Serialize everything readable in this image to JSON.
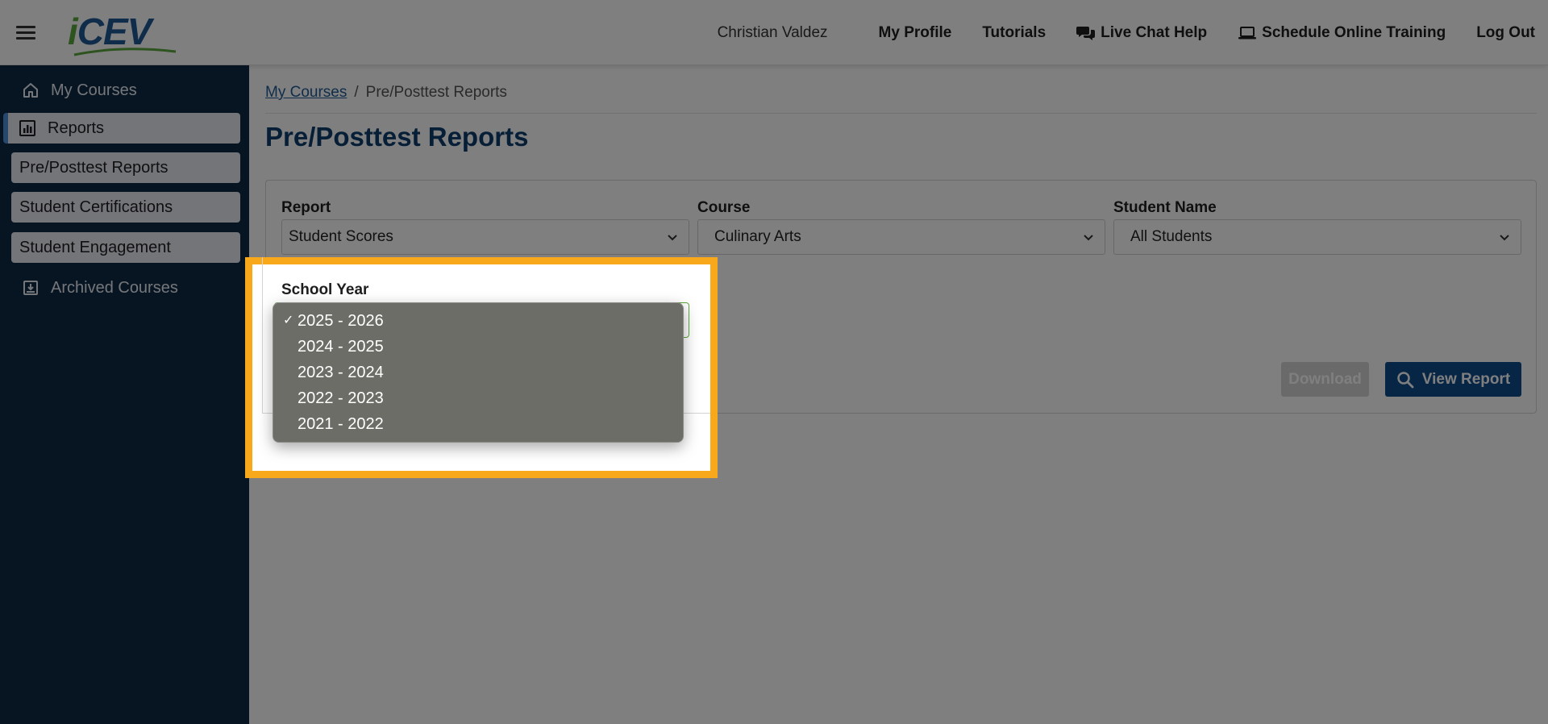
{
  "header": {
    "logo_text": "iCEV",
    "user_name": "Christian Valdez",
    "links": {
      "my_profile": "My Profile",
      "tutorials": "Tutorials",
      "live_chat": "Live Chat Help",
      "schedule_training": "Schedule Online Training",
      "log_out": "Log Out"
    }
  },
  "sidebar": {
    "items": [
      {
        "label": "My Courses",
        "icon": "home-icon"
      },
      {
        "label": "Reports",
        "icon": "report-chart-icon"
      },
      {
        "label": "Pre/Posttest Reports"
      },
      {
        "label": "Student Certifications"
      },
      {
        "label": "Student Engagement"
      },
      {
        "label": "Archived Courses",
        "icon": "archive-icon"
      }
    ]
  },
  "breadcrumb": {
    "home": "My Courses",
    "separator": "/",
    "current": "Pre/Posttest Reports"
  },
  "page_title": "Pre/Posttest Reports",
  "filters": {
    "report": {
      "label": "Report",
      "value": "Student Scores"
    },
    "course": {
      "label": "Course",
      "value": "Culinary Arts"
    },
    "student": {
      "label": "Student Name",
      "value": "All Students"
    },
    "school_year": {
      "label": "School Year",
      "selected": "2025 - 2026",
      "check": "✓",
      "options": [
        "2025 - 2026",
        "2024 - 2025",
        "2023 - 2024",
        "2022 - 2023",
        "2021 - 2022"
      ]
    }
  },
  "buttons": {
    "download": "Download",
    "view_report": "View Report"
  },
  "colors": {
    "header_bg": "#ffffff",
    "sidebar_bg": "#0f2a47",
    "title_blue": "#0f3c6e",
    "primary_button": "#0f4c8c",
    "highlight_frame": "#f7a81b",
    "logo_green": "#5aa83c",
    "logo_blue": "#1e5b94"
  }
}
